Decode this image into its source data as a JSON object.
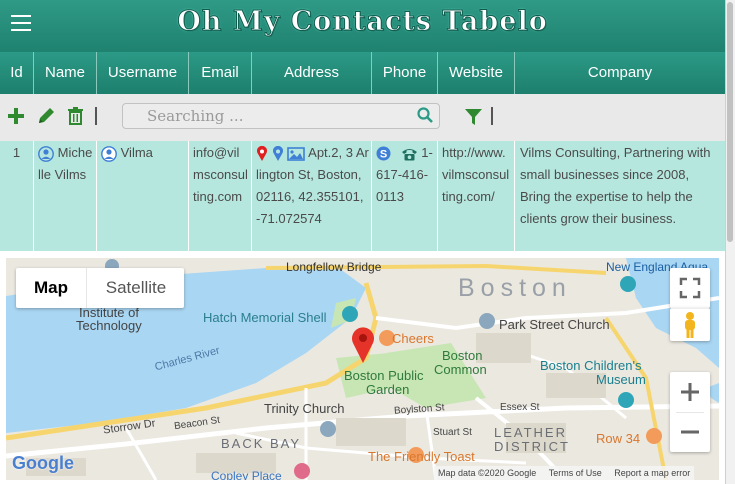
{
  "app": {
    "title": "Oh My Contacts Tabelo"
  },
  "columns": [
    "Id",
    "Name",
    "Username",
    "Email",
    "Address",
    "Phone",
    "Website",
    "Company"
  ],
  "toolbar": {
    "search_placeholder": "Searching ..."
  },
  "record": {
    "id": "1",
    "name": "Michelle Vilms",
    "username": "Vilma",
    "email": "info@vilmsconsulting.com",
    "address": "Apt.2, 3 Arlington St, Boston, 02116, 42.355101, -71.072574",
    "phone": "1-617-416-0113",
    "website": "http://www.vilmsconsulting.com/",
    "company": "Vilms Consulting, Partnering with small businesses since 2008, Bring the expertise to help the clients grow their business."
  },
  "map": {
    "type_map": "Map",
    "type_satellite": "Satellite",
    "labels": {
      "longfellow": "Longfellow Bridge",
      "new_england": "New England Aqua",
      "boston": "Boston",
      "institute": "Institute of",
      "technology": "Technology",
      "hatch": "Hatch Memorial Shell",
      "cheers": "Cheers",
      "park_street": "Park Street Church",
      "charles": "Charles River",
      "boston_common_1": "Boston",
      "boston_common_2": "Common",
      "public_garden_1": "Boston Public",
      "public_garden_2": "Garden",
      "childrens_1": "Boston Children's",
      "childrens_2": "Museum",
      "trinity": "Trinity Church",
      "boylston": "Boylston St",
      "essex": "Essex St",
      "storrow": "Storrow Dr",
      "beacon": "Beacon St",
      "back_bay": "BACK BAY",
      "stuart": "Stuart St",
      "leather_1": "LEATHER",
      "leather_2": "DISTRICT",
      "row34": "Row 34",
      "friendly_toast": "The Friendly Toast",
      "copley": "Copley Place"
    },
    "footer": {
      "google": "Google",
      "data": "Map data ©2020 Google",
      "terms": "Terms of Use",
      "report": "Report a map error"
    }
  }
}
